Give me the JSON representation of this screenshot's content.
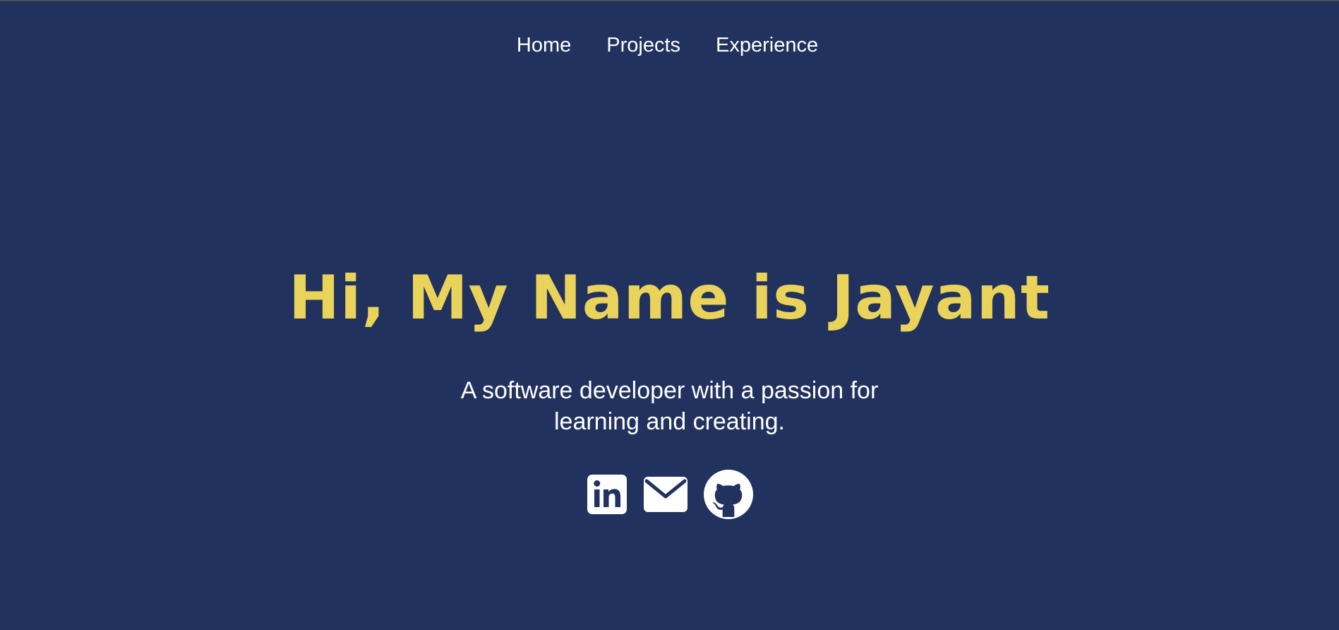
{
  "nav": {
    "items": [
      {
        "label": "Home"
      },
      {
        "label": "Projects"
      },
      {
        "label": "Experience"
      }
    ]
  },
  "hero": {
    "title": "Hi, My Name is Jayant",
    "subtitle": "A software developer with a passion for learning and creating."
  },
  "social": {
    "links": [
      {
        "icon": "linkedin-icon"
      },
      {
        "icon": "email-icon"
      },
      {
        "icon": "github-icon"
      }
    ]
  },
  "colors": {
    "background": "#22325e",
    "accent": "#e9d35a",
    "text": "#ffffff"
  }
}
